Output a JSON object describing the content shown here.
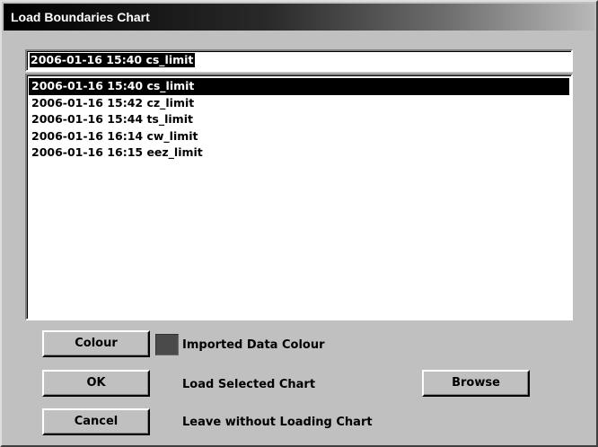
{
  "window": {
    "title": "Load Boundaries Chart"
  },
  "name_field": {
    "value": "2006-01-16 15:40 cs_limit"
  },
  "charts_list": {
    "items": [
      "2006-01-16 15:40 cs_limit",
      "2006-01-16 15:42 cz_limit",
      "2006-01-16 15:44 ts_limit",
      "2006-01-16 16:14 cw_limit",
      "2006-01-16 16:15 eez_limit"
    ],
    "selected_index": 0
  },
  "colour_row": {
    "button_label": "Colour",
    "swatch_color": "#4a4a4a",
    "description": "Imported Data Colour"
  },
  "ok_row": {
    "button_label": "OK",
    "description": "Load Selected Chart"
  },
  "browse": {
    "button_label": "Browse"
  },
  "cancel_row": {
    "button_label": "Cancel",
    "description": "Leave without Loading Chart"
  }
}
